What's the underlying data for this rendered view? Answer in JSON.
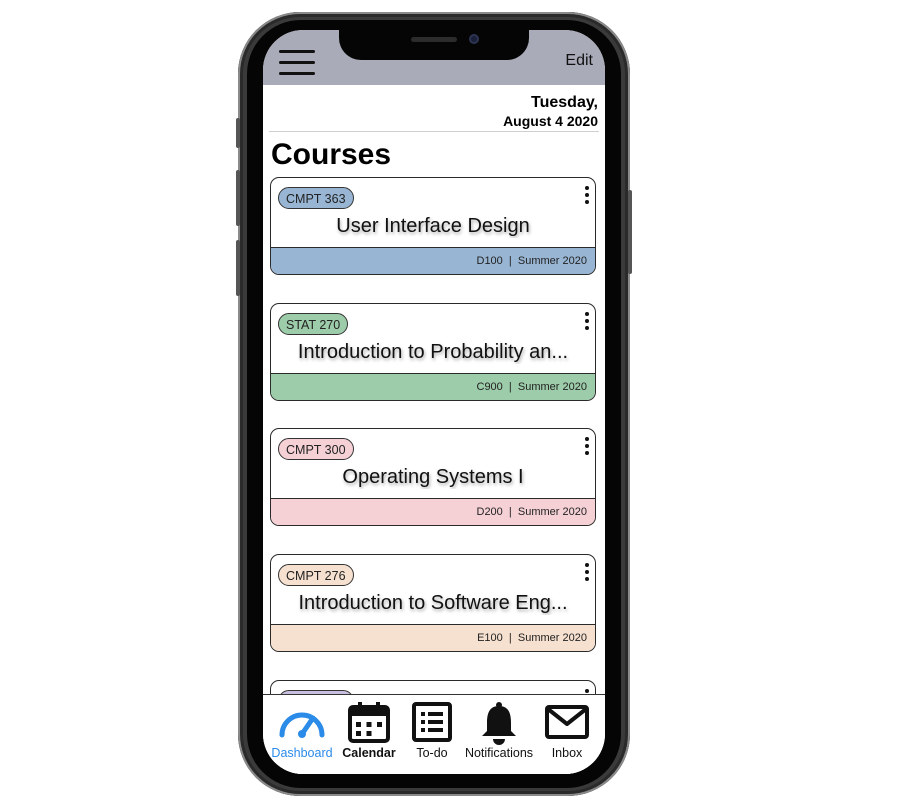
{
  "header": {
    "menu_icon": "hamburger-menu-icon",
    "edit_label": "Edit"
  },
  "date": {
    "line1": "Tuesday,",
    "line2": "August 4 2020"
  },
  "page_title": "Courses",
  "courses": [
    {
      "code": "CMPT 363",
      "title": "User Interface Design",
      "section": "D100",
      "term": "Summer 2020",
      "color": "#98b6d4"
    },
    {
      "code": "STAT 270",
      "title": "Introduction to Probability an...",
      "section": "C900",
      "term": "Summer 2020",
      "color": "#9ccca9"
    },
    {
      "code": "CMPT 300",
      "title": "Operating Systems I",
      "section": "D200",
      "term": "Summer 2020",
      "color": "#f5d1d6"
    },
    {
      "code": "CMPT 276",
      "title": "Introduction to Software Eng...",
      "section": "E100",
      "term": "Summer 2020",
      "color": "#f6e0d0"
    },
    {
      "color": "#c9bfe0"
    }
  ],
  "tabs": [
    {
      "label": "Dashboard",
      "icon": "speedometer-icon",
      "active": true
    },
    {
      "label": "Calendar",
      "icon": "calendar-icon",
      "active": false
    },
    {
      "label": "To-do",
      "icon": "list-icon",
      "active": false
    },
    {
      "label": "Notifications",
      "icon": "bell-icon",
      "active": false
    },
    {
      "label": "Inbox",
      "icon": "envelope-icon",
      "active": false
    }
  ],
  "colors": {
    "topbar": "#a9abb8",
    "active_tab": "#2b8be8"
  }
}
